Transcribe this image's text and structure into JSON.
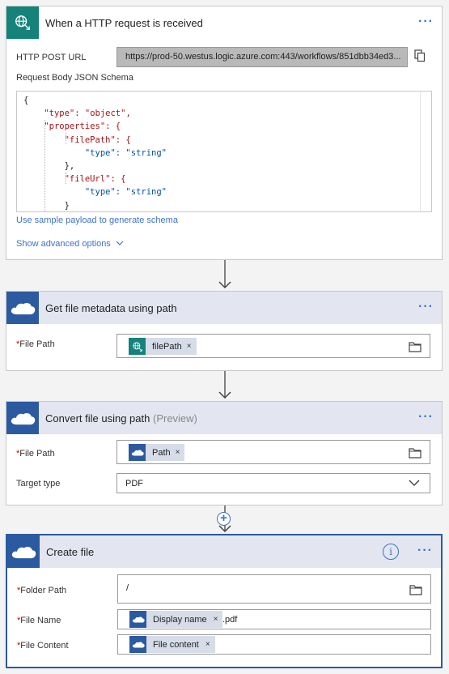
{
  "colors": {
    "accent": "#3c73c6",
    "trigger_icon_bg": "#15837a",
    "onedrive_bg": "#2c5aa0",
    "header_bg": "#e3e6f0",
    "required": "#cc0000"
  },
  "trigger": {
    "title": "When a HTTP request is received",
    "url_label": "HTTP POST URL",
    "url_value": "https://prod-50.westus.logic.azure.com:443/workflows/851dbb34ed3...",
    "schema_label": "Request Body JSON Schema",
    "schema_lines": [
      "{",
      "\"type\": \"object\",",
      "\"properties\": {",
      "\"filePath\": {",
      "\"type\": \"string\"",
      "},",
      "\"fileUrl\": {",
      "\"type\": \"string\"",
      "}"
    ],
    "sample_link": "Use sample payload to generate schema",
    "advanced_link": "Show advanced options",
    "menu": "···"
  },
  "metadata_step": {
    "title": "Get file metadata using path",
    "menu": "···",
    "required_mark": "*",
    "file_path_label": "File Path",
    "file_path_token": "filePath",
    "token_remove": "×",
    "folder_icon": "folder-icon"
  },
  "convert_step": {
    "title": "Convert file using path",
    "title_suffix": "(Preview)",
    "menu": "···",
    "required_mark": "*",
    "file_path_label": "File Path",
    "file_path_token": "Path",
    "token_remove": "×",
    "target_label": "Target type",
    "target_value": "PDF"
  },
  "add_step": {
    "symbol": "+"
  },
  "create_step": {
    "title": "Create file",
    "info": "i",
    "menu": "···",
    "required_mark": "*",
    "folder_label": "Folder Path",
    "folder_value": "/",
    "name_label": "File Name",
    "name_token": "Display name",
    "name_suffix": ".pdf",
    "content_label": "File Content",
    "content_token": "File content",
    "token_remove": "×"
  }
}
